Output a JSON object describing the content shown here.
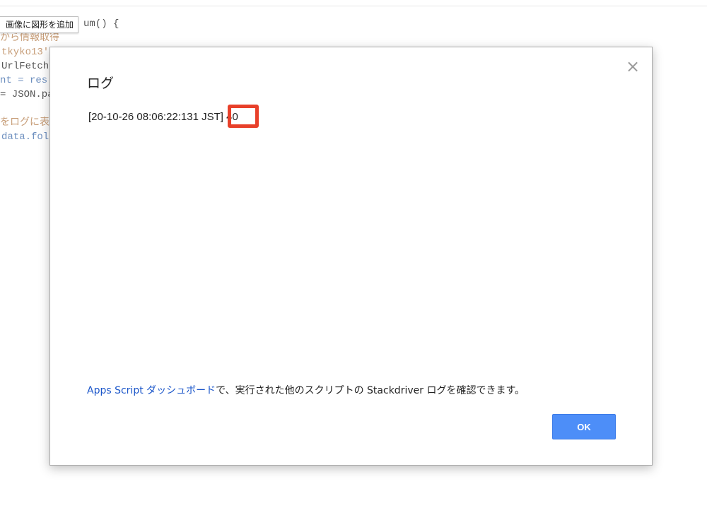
{
  "tooltip": {
    "text": "画像に図形を追加"
  },
  "code_lines": [
    {
      "text": "um() {",
      "style": "c-default"
    },
    {
      "text": "から情報取得",
      "style": "c-comment"
    },
    {
      "text": "tkyko13'",
      "style": "c-comment"
    },
    {
      "text": "UrlFetch",
      "style": "c-default"
    },
    {
      "text": "nt = res.",
      "style": "c-var"
    },
    {
      "text": "= JSON.pa",
      "style": "c-default"
    },
    {
      "text": "",
      "style": "c-default"
    },
    {
      "text": "をログに表示",
      "style": "c-comment"
    },
    {
      "text": "data.fol",
      "style": "c-var"
    }
  ],
  "dialog": {
    "title": "ログ",
    "close_symbol": "×",
    "log_text": "[20-10-26 08:06:22:131 JST] 40",
    "footer": {
      "link_text": "Apps Script ダッシュボード",
      "rest_text": "で、実行された他のスクリプトの Stackdriver ログを確認できます。"
    },
    "ok_label": "OK"
  },
  "colors": {
    "highlight": "#e8402a",
    "ok_button": "#4d8ef8",
    "link": "#1a55c9"
  }
}
